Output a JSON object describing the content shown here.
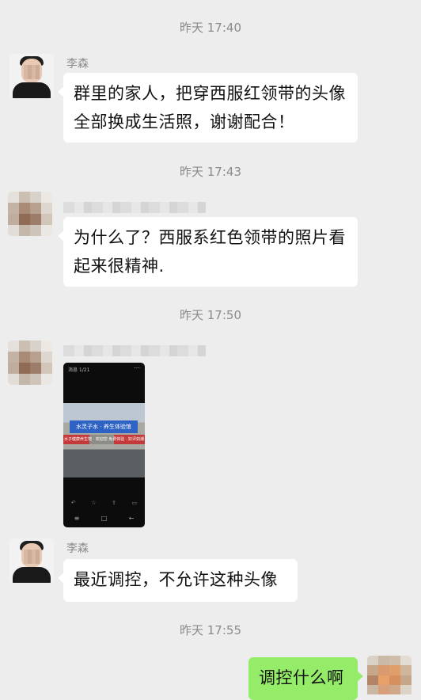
{
  "messages": {
    "t1": "昨天 17:40",
    "m1": {
      "name": "李森",
      "text": "群里的家人，把穿西服红领带的头像全部换成生活照，谢谢配合！"
    },
    "t2": "昨天 17:43",
    "m2": {
      "text": "为什么了？西服系红色领带的照片看起来很精神."
    },
    "t3": "昨天 17:50",
    "m3": {
      "screenshot": {
        "status_text": "消息 1/21",
        "menu_icon": "more-icon",
        "sign_text": "水灵子水 · 养生体验馆",
        "shop_left": "水子健康养生馆 · 欢迎您",
        "shop_right": "免费体验 · 好评如潮",
        "sys_icons": [
          "reply-icon",
          "star-icon",
          "share-icon",
          "trash-icon"
        ],
        "nav_icons": [
          "menu-icon",
          "home-icon",
          "back-icon"
        ]
      }
    },
    "m4": {
      "name": "李森",
      "text": "最近调控，不允许这种头像"
    },
    "t4": "昨天 17:55",
    "m5": {
      "text": "调控什么啊"
    }
  },
  "colors": {
    "background": "#ededed",
    "bubble_other": "#ffffff",
    "bubble_self": "#95ec69"
  }
}
